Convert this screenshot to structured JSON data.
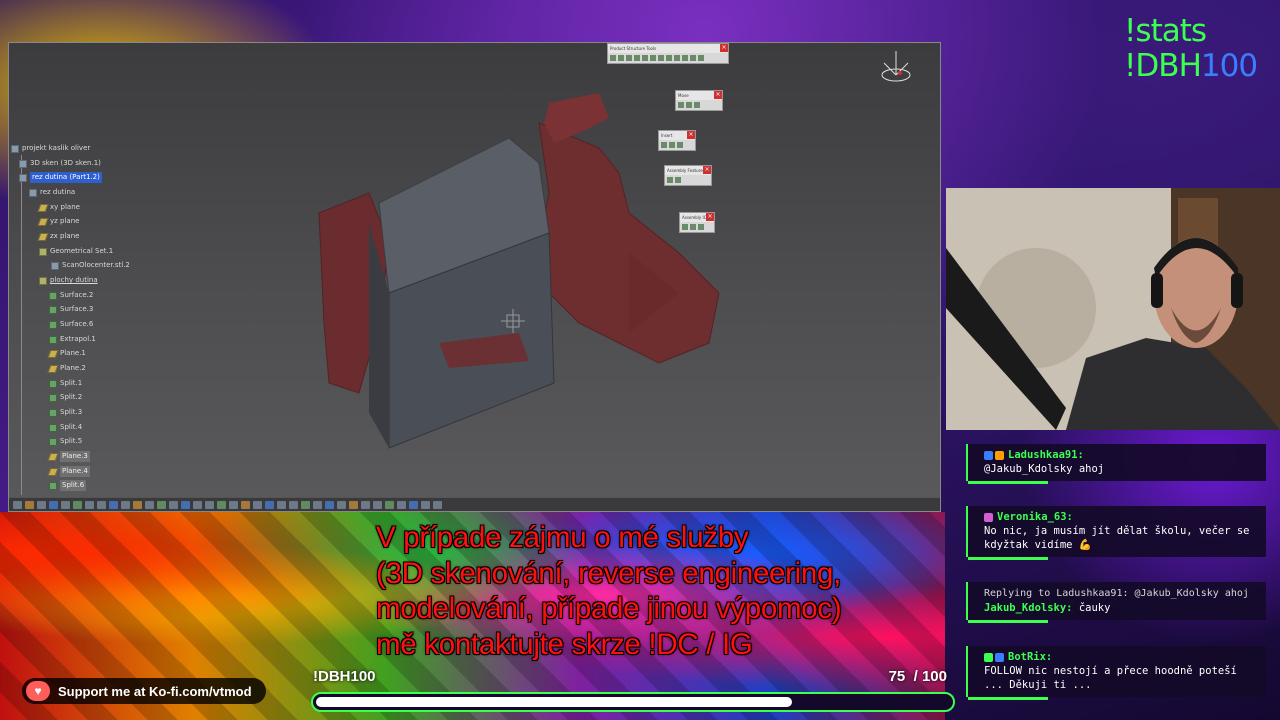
{
  "stream_overlay": {
    "stats_command": "!stats",
    "dbh_command_prefix": "!DBH",
    "dbh_command_number": "100",
    "kofi_text": "Support me at Ko-fi.com/vtmod",
    "goal": {
      "label": "!DBH100",
      "current": "75",
      "separator": "/",
      "target": "100",
      "progress_fraction": 0.75
    },
    "subtitle_lines": [
      "V případe zájmu o mé služby",
      "(3D skenování, reverse engineering,",
      "modelování, případe jinou výpomoc)",
      "mě kontaktujte skrze !DC / IG"
    ],
    "colors": {
      "accent_green": "#3cff50",
      "accent_blue": "#3b7dff",
      "subtitle_red": "#ff1010"
    }
  },
  "cad": {
    "tree": [
      "projekt kaslik oliver",
      "3D sken (3D sken.1)",
      "rez dutina (Part1.2)",
      "rez dutina",
      "xy plane",
      "yz plane",
      "zx plane",
      "Geometrical Set.1",
      "ScanOlocenter.stl.2",
      "plochy dutina",
      "Surface.2",
      "Surface.3",
      "Surface.6",
      "Extrapol.1",
      "Plane.1",
      "Plane.2",
      "Split.1",
      "Split.2",
      "Split.3",
      "Split.4",
      "Split.5",
      "Plane.3",
      "Plane.4",
      "Split.6"
    ],
    "floating_toolbars": [
      {
        "title": "Product Structure Tools"
      },
      {
        "title": "Move"
      },
      {
        "title": "Insert"
      },
      {
        "title": "Assembly Features"
      },
      {
        "title": "Assembly IC"
      }
    ]
  },
  "chat": {
    "messages": [
      {
        "name": "Ladushkaa91:",
        "name_color": "#3cff50",
        "badges": [
          "#3b7dff",
          "#ffa000"
        ],
        "text": "@Jakub_Kdolsky ahoj",
        "reply": ""
      },
      {
        "name": "Veronika_63:",
        "name_color": "#3cff50",
        "badges": [
          "#d060d0"
        ],
        "text": "No nic, ja musím jít dělat školu, večer se kdyžtak vidíme 💪",
        "reply": ""
      },
      {
        "name": "Jakub_Kdolsky:",
        "name_color": "#3cff50",
        "badges": [],
        "text": "čauky",
        "reply": "Replying to Ladushkaa91: @Jakub_Kdolsky ahoj"
      },
      {
        "name": "BotRix:",
        "name_color": "#3cff50",
        "badges": [
          "#3cff50",
          "#3b7dff"
        ],
        "text": "FOLLOW nic nestojí a přece hoodně poteší ... Děkuji ti ...",
        "reply": ""
      }
    ]
  }
}
